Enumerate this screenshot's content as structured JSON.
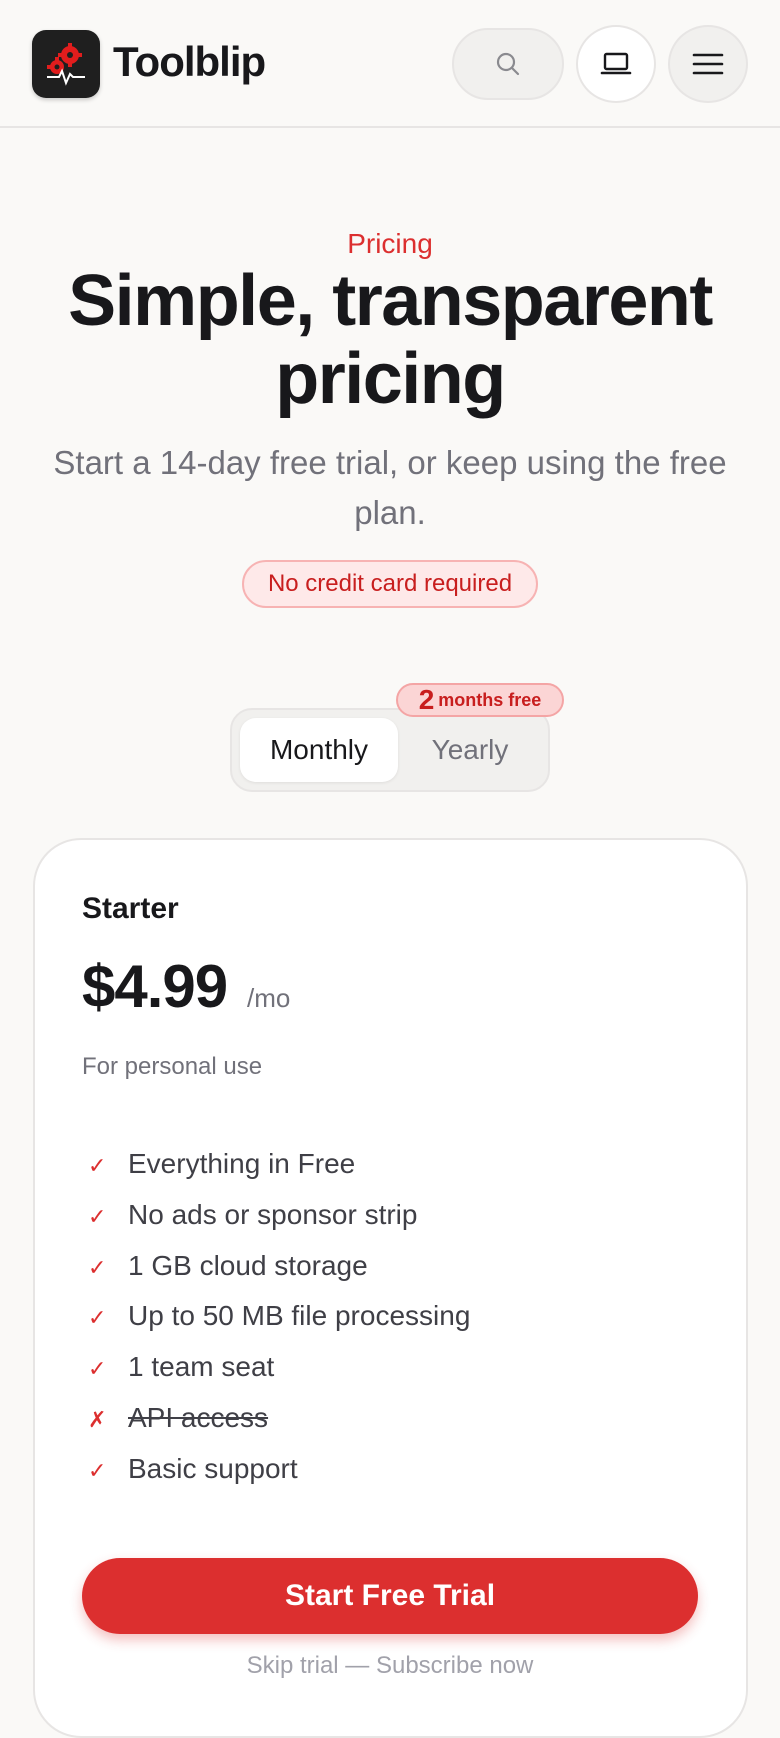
{
  "header": {
    "brand": "Toolblip",
    "icons": {
      "logo": "gear-pulse-logo",
      "search": "search-icon",
      "device": "laptop-icon",
      "menu": "hamburger-menu-icon"
    }
  },
  "hero": {
    "eyebrow": "Pricing",
    "title": "Simple, transparent pricing",
    "subtitle": "Start a 14-day free trial, or keep using the free plan.",
    "badge": "No credit card required"
  },
  "billing": {
    "options": [
      "Monthly",
      "Yearly"
    ],
    "selected": "Monthly",
    "promo_number": "2",
    "promo_text": "months free"
  },
  "plan": {
    "name": "Starter",
    "price": "$4.99",
    "period": "/mo",
    "description": "For personal use",
    "features": [
      {
        "text": "Everything in Free",
        "included": true,
        "mark": "✓"
      },
      {
        "text": "No ads or sponsor strip",
        "included": true,
        "mark": "✓"
      },
      {
        "text": "1 GB cloud storage",
        "included": true,
        "mark": "✓"
      },
      {
        "text": "Up to 50 MB file processing",
        "included": true,
        "mark": "✓"
      },
      {
        "text": "1 team seat",
        "included": true,
        "mark": "✓"
      },
      {
        "text": "API access",
        "included": false,
        "mark": "✗"
      },
      {
        "text": "Basic support",
        "included": true,
        "mark": "✓"
      }
    ],
    "cta": "Start Free Trial",
    "secondary": "Skip trial — Subscribe now"
  },
  "colors": {
    "accent": "#dc2f2f",
    "background": "#faf9f7",
    "text": "#18181b",
    "muted": "#71717a"
  }
}
